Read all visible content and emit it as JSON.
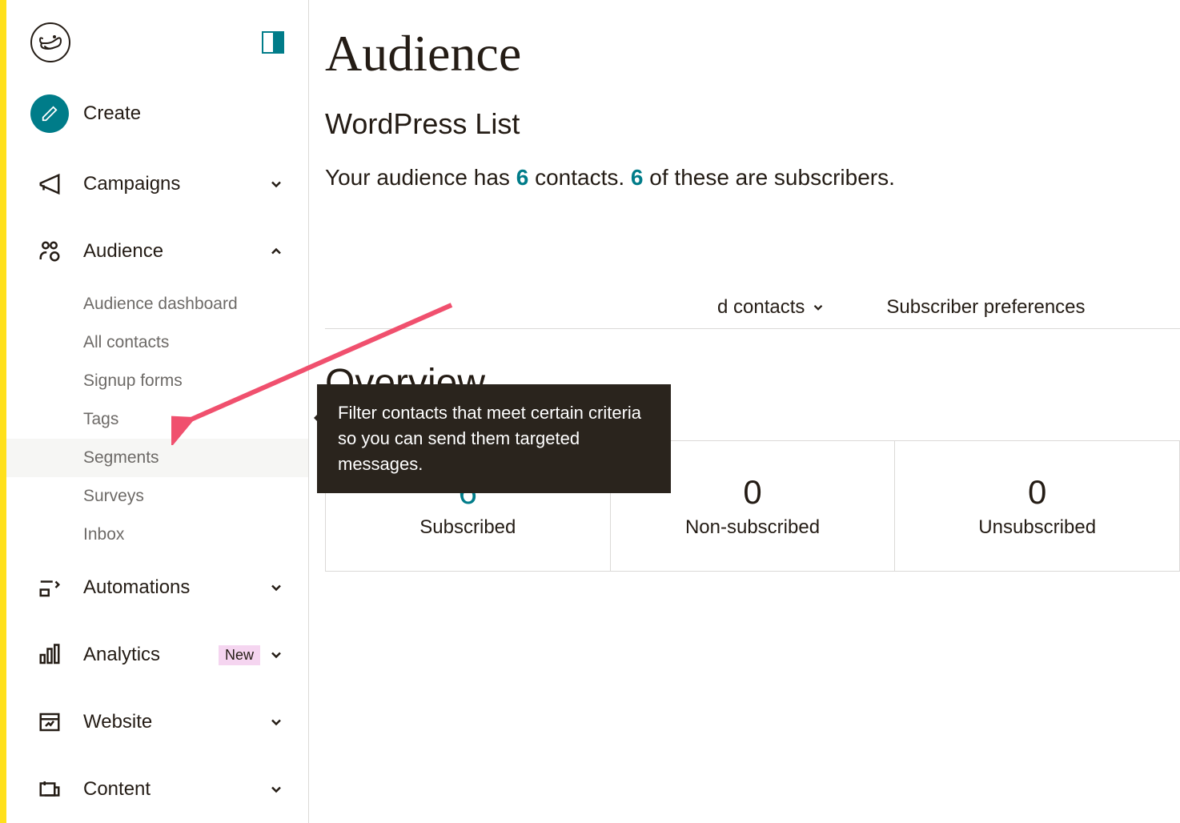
{
  "sidebar": {
    "create_label": "Create",
    "items": [
      {
        "key": "campaigns",
        "label": "Campaigns",
        "expandable": true,
        "expanded": false
      },
      {
        "key": "audience",
        "label": "Audience",
        "expandable": true,
        "expanded": true,
        "subitems": [
          {
            "key": "dashboard",
            "label": "Audience dashboard"
          },
          {
            "key": "all-contacts",
            "label": "All contacts"
          },
          {
            "key": "signup-forms",
            "label": "Signup forms"
          },
          {
            "key": "tags",
            "label": "Tags"
          },
          {
            "key": "segments",
            "label": "Segments",
            "active": true
          },
          {
            "key": "surveys",
            "label": "Surveys"
          },
          {
            "key": "inbox",
            "label": "Inbox"
          }
        ]
      },
      {
        "key": "automations",
        "label": "Automations",
        "expandable": true,
        "expanded": false
      },
      {
        "key": "analytics",
        "label": "Analytics",
        "expandable": true,
        "expanded": false,
        "badge": "New"
      },
      {
        "key": "website",
        "label": "Website",
        "expandable": true,
        "expanded": false
      },
      {
        "key": "content",
        "label": "Content",
        "expandable": true,
        "expanded": false
      }
    ]
  },
  "main": {
    "page_title": "Audience",
    "list_title": "WordPress List",
    "summary": {
      "prefix": "Your audience has ",
      "contacts_count": "6",
      "mid": " contacts. ",
      "subscribers_count": "6",
      "suffix": " of these are subscribers."
    },
    "tabs": {
      "add_contacts_partial": "d contacts",
      "subscriber_prefs": "Subscriber preferences"
    },
    "section_title": "Overview",
    "stats": [
      {
        "key": "subscribed",
        "number": "6",
        "label": "Subscribed",
        "accent": true
      },
      {
        "key": "non-subscribed",
        "number": "0",
        "label": "Non-subscribed",
        "accent": false
      },
      {
        "key": "unsubscribed",
        "number": "0",
        "label": "Unsubscribed",
        "accent": false
      }
    ]
  },
  "tooltip": {
    "text": "Filter contacts that meet certain criteria so you can send them targeted messages."
  }
}
